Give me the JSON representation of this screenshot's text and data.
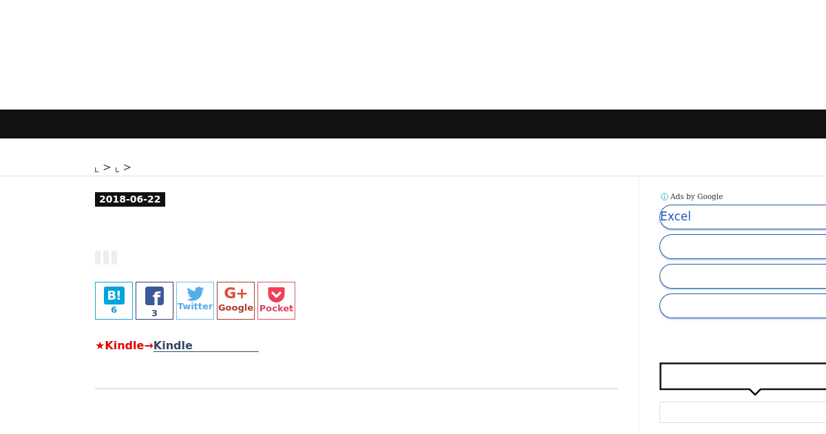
{
  "breadcrumb": [
    {
      "separator": ">"
    },
    {
      "separator": ">"
    }
  ],
  "post": {
    "date": "2018-06-22",
    "share_buttons": [
      {
        "kind": "hatena",
        "logo": "B!",
        "label": "6"
      },
      {
        "kind": "facebook",
        "logo": "f",
        "label": "3"
      },
      {
        "kind": "twitter",
        "label": "Twitter"
      },
      {
        "kind": "google",
        "logo": "G+",
        "label": "Google"
      },
      {
        "kind": "pocket",
        "label": "Pocket"
      }
    ],
    "notice": {
      "prefix": "★Kindle→",
      "link": "Kindle"
    }
  },
  "sidebar": {
    "ad_label": "Ads by Google",
    "ad_links": [
      {
        "kind": "text",
        "text": "Excel"
      },
      {
        "kind": "empty"
      },
      {
        "kind": "empty"
      },
      {
        "kind": "empty"
      }
    ]
  }
}
